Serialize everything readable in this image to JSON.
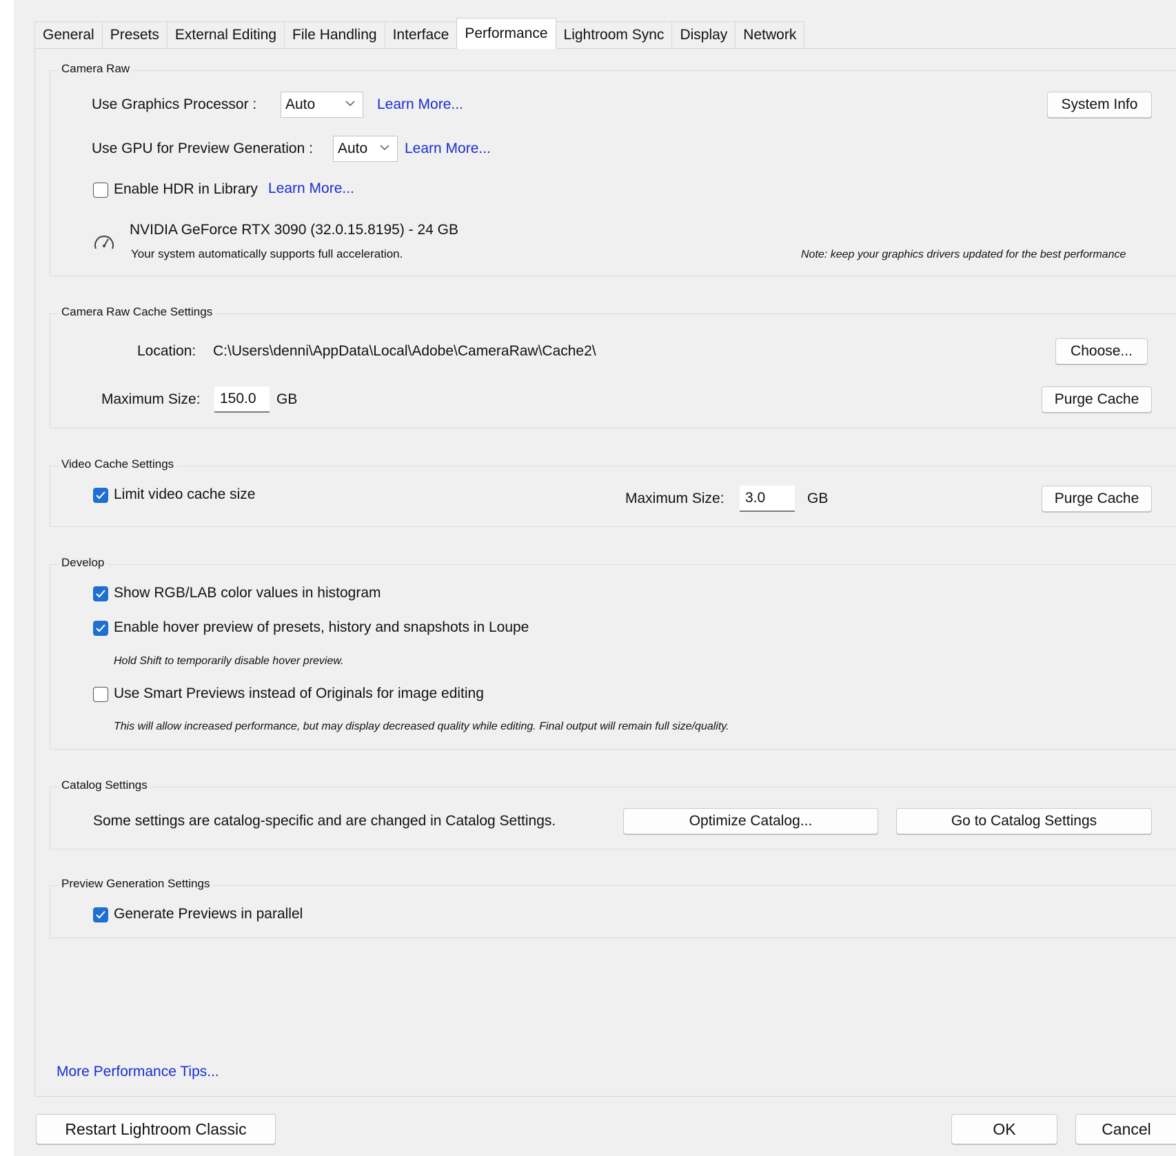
{
  "tabs": [
    "General",
    "Presets",
    "External Editing",
    "File Handling",
    "Interface",
    "Performance",
    "Lightroom Sync",
    "Display",
    "Network"
  ],
  "camera_raw": {
    "title": "Camera Raw",
    "gpu_label": "Use Graphics Processor :",
    "gpu_value": "Auto",
    "learn_more": "Learn More...",
    "system_info": "System Info",
    "gpu_preview_label": "Use GPU for Preview Generation :",
    "gpu_preview_value": "Auto",
    "hdr_label": "Enable HDR in Library",
    "hdr_checked": false,
    "gpu_name": "NVIDIA GeForce RTX 3090 (32.0.15.8195) - 24 GB",
    "gpu_status": "Your system automatically supports full acceleration.",
    "driver_note": "Note: keep your graphics drivers updated for the best performance",
    "gauge_icon": "speedometer-icon"
  },
  "cache": {
    "title": "Camera Raw Cache Settings",
    "location_label": "Location:",
    "location_value": "C:\\Users\\denni\\AppData\\Local\\Adobe\\CameraRaw\\Cache2\\",
    "choose": "Choose...",
    "max_label": "Maximum Size:",
    "max_value": "150.0",
    "unit": "GB",
    "purge": "Purge Cache"
  },
  "video": {
    "title": "Video Cache Settings",
    "limit_label": "Limit video cache size",
    "limit_checked": true,
    "max_label": "Maximum Size:",
    "max_value": "3.0",
    "unit": "GB",
    "purge": "Purge Cache"
  },
  "develop": {
    "title": "Develop",
    "rgb_label": "Show RGB/LAB color values in histogram",
    "hover_label": "Enable hover preview of presets, history and snapshots in Loupe",
    "hover_note": "Hold Shift to temporarily disable hover preview.",
    "smart_label": "Use Smart Previews instead of Originals for image editing",
    "smart_note": "This will allow increased performance, but may display decreased quality while editing. Final output will remain full size/quality."
  },
  "catalog": {
    "title": "Catalog Settings",
    "text": "Some settings are catalog-specific and are changed in Catalog Settings.",
    "optimize": "Optimize Catalog...",
    "goto": "Go to Catalog Settings"
  },
  "preview": {
    "title": "Preview Generation Settings",
    "parallel_label": "Generate Previews in parallel"
  },
  "footer": {
    "tips": "More Performance Tips...",
    "restart": "Restart Lightroom Classic",
    "ok": "OK",
    "cancel": "Cancel"
  },
  "colors": {
    "accent": "#1f6fd1",
    "link": "#1a2ecf"
  }
}
